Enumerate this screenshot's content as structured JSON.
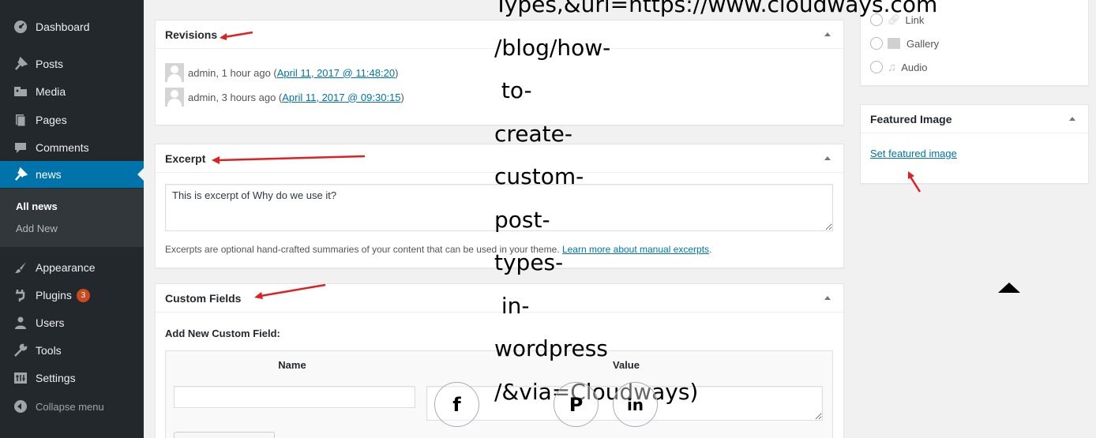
{
  "sidebar": {
    "items": [
      {
        "label": "Dashboard",
        "icon": "dashboard-icon"
      },
      {
        "label": "Posts",
        "icon": "pin-icon"
      },
      {
        "label": "Media",
        "icon": "media-icon"
      },
      {
        "label": "Pages",
        "icon": "pages-icon"
      },
      {
        "label": "Comments",
        "icon": "comments-icon"
      },
      {
        "label": "news",
        "icon": "pin-icon"
      },
      {
        "label": "Appearance",
        "icon": "paintbrush-icon"
      },
      {
        "label": "Plugins",
        "icon": "plugins-icon",
        "badge": "3"
      },
      {
        "label": "Users",
        "icon": "users-icon"
      },
      {
        "label": "Tools",
        "icon": "wrench-icon"
      },
      {
        "label": "Settings",
        "icon": "settings-icon"
      },
      {
        "label": "Collapse menu",
        "icon": "collapse-icon"
      }
    ],
    "submenu": {
      "all": "All news",
      "add": "Add New"
    }
  },
  "revisions": {
    "title": "Revisions",
    "rows": [
      {
        "author": "admin, 1 hour ago (",
        "date": "April 11, 2017 @ 11:48:20",
        "close": ")"
      },
      {
        "author": "admin, 3 hours ago (",
        "date": "April 11, 2017 @ 09:30:15",
        "close": ")"
      }
    ]
  },
  "excerpt": {
    "title": "Excerpt",
    "value": "This is excerpt of Why do we use it?",
    "help_text": "Excerpts are optional hand-crafted summaries of your content that can be used in your theme. ",
    "help_link": "Learn more about manual excerpts",
    "help_end": "."
  },
  "custom_fields": {
    "title": "Custom Fields",
    "add_label": "Add New Custom Field:",
    "col_name": "Name",
    "col_value": "Value"
  },
  "format_box": {
    "options": [
      "Link",
      "Gallery",
      "Audio"
    ]
  },
  "featured_image": {
    "title": "Featured Image",
    "link": "Set featured image"
  },
  "share_overlay": {
    "url_lines": [
      "Types,&url=https://www.cloudways.com",
      "/blog/how-",
      " to-",
      "create-",
      "custom-",
      "post-",
      "types-",
      " in-",
      "wordpress",
      "/&via=Cloudways)"
    ],
    "facebook_glyph": "f",
    "pinterest_glyph": "P",
    "linkedin_glyph": "in"
  },
  "colors": {
    "sidebar_bg": "#23282d",
    "active_bg": "#0073aa",
    "link": "#0073aa",
    "badge": "#ca4a1f",
    "annotation_arrow": "#e02020"
  }
}
